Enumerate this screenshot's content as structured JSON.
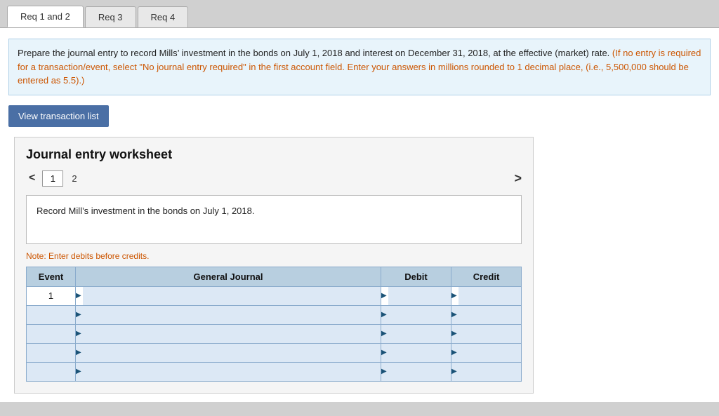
{
  "tabs": [
    {
      "id": "req1-2",
      "label": "Req 1 and 2",
      "active": true
    },
    {
      "id": "req3",
      "label": "Req 3",
      "active": false
    },
    {
      "id": "req4",
      "label": "Req 4",
      "active": false
    }
  ],
  "instructions": {
    "main_text": "Prepare the journal entry to record Mills’ investment in the bonds on July 1, 2018 and interest on December 31, 2018, at the effective (market) rate.",
    "note_text": "(If no entry is required for a transaction/event, select \"No journal entry required\" in the first account field. Enter your answers in millions rounded to 1 decimal place, (i.e., 5,500,000 should be entered as 5.5).)"
  },
  "view_transaction_button": "View transaction list",
  "worksheet": {
    "title": "Journal entry worksheet",
    "nav_left_arrow": "<",
    "nav_right_arrow": ">",
    "current_page": "1",
    "total_pages": "2",
    "description": "Record Mill’s investment in the bonds on July 1, 2018.",
    "note": "Note: Enter debits before credits.",
    "table": {
      "columns": [
        "Event",
        "General Journal",
        "Debit",
        "Credit"
      ],
      "rows": [
        {
          "event": "1",
          "journal": "",
          "debit": "",
          "credit": ""
        },
        {
          "event": "",
          "journal": "",
          "debit": "",
          "credit": ""
        },
        {
          "event": "",
          "journal": "",
          "debit": "",
          "credit": ""
        },
        {
          "event": "",
          "journal": "",
          "debit": "",
          "credit": ""
        },
        {
          "event": "",
          "journal": "",
          "debit": "",
          "credit": ""
        }
      ]
    }
  }
}
